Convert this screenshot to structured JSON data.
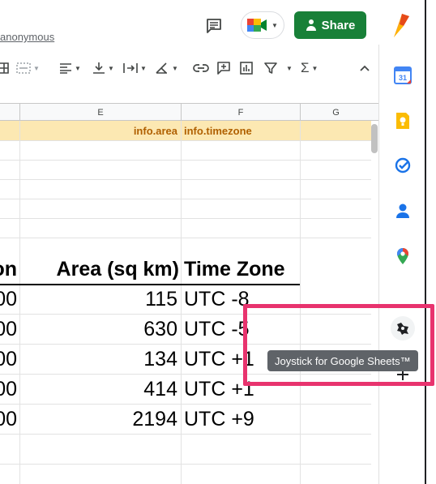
{
  "header": {
    "edit_link": "anonymous",
    "share_label": "Share",
    "icons": [
      "comment-icon",
      "meet-icon",
      "lock-person-icon",
      "brand-logo"
    ]
  },
  "toolbar": {
    "buttons": [
      "grid-icon",
      "merge-icon",
      "align-icon",
      "valign-icon",
      "wrap-icon",
      "rotate-icon",
      "link-icon",
      "comment-add-icon",
      "chart-icon",
      "filter-icon",
      "functions-icon",
      "collapse-icon"
    ]
  },
  "sheet": {
    "columns": [
      "E",
      "F",
      "G"
    ],
    "row1": {
      "e": "info.area",
      "f": "info.timezone"
    },
    "headers": {
      "partial": "on",
      "area": "Area (sq km)",
      "tz": "Time Zone"
    },
    "rows": [
      {
        "partial": "00",
        "area": "115",
        "tz": "UTC -8"
      },
      {
        "partial": "00",
        "area": "630",
        "tz": "UTC -5"
      },
      {
        "partial": "00",
        "area": "134",
        "tz": "UTC +1"
      },
      {
        "partial": "00",
        "area": "414",
        "tz": "UTC +1"
      },
      {
        "partial": "00",
        "area": "2194",
        "tz": "UTC +9"
      }
    ]
  },
  "side_panel": {
    "apps": [
      "calendar-icon",
      "keep-icon",
      "tasks-icon",
      "contacts-icon",
      "maps-icon",
      "joystick-icon",
      "add-icon"
    ]
  },
  "tooltip": {
    "text": "Joystick for Google Sheets™"
  },
  "colors": {
    "share_bg": "#188038",
    "header_row_bg": "#fce8b2",
    "header_row_text": "#b06000",
    "highlight": "#e8336e",
    "tooltip_bg": "#5f6368"
  }
}
